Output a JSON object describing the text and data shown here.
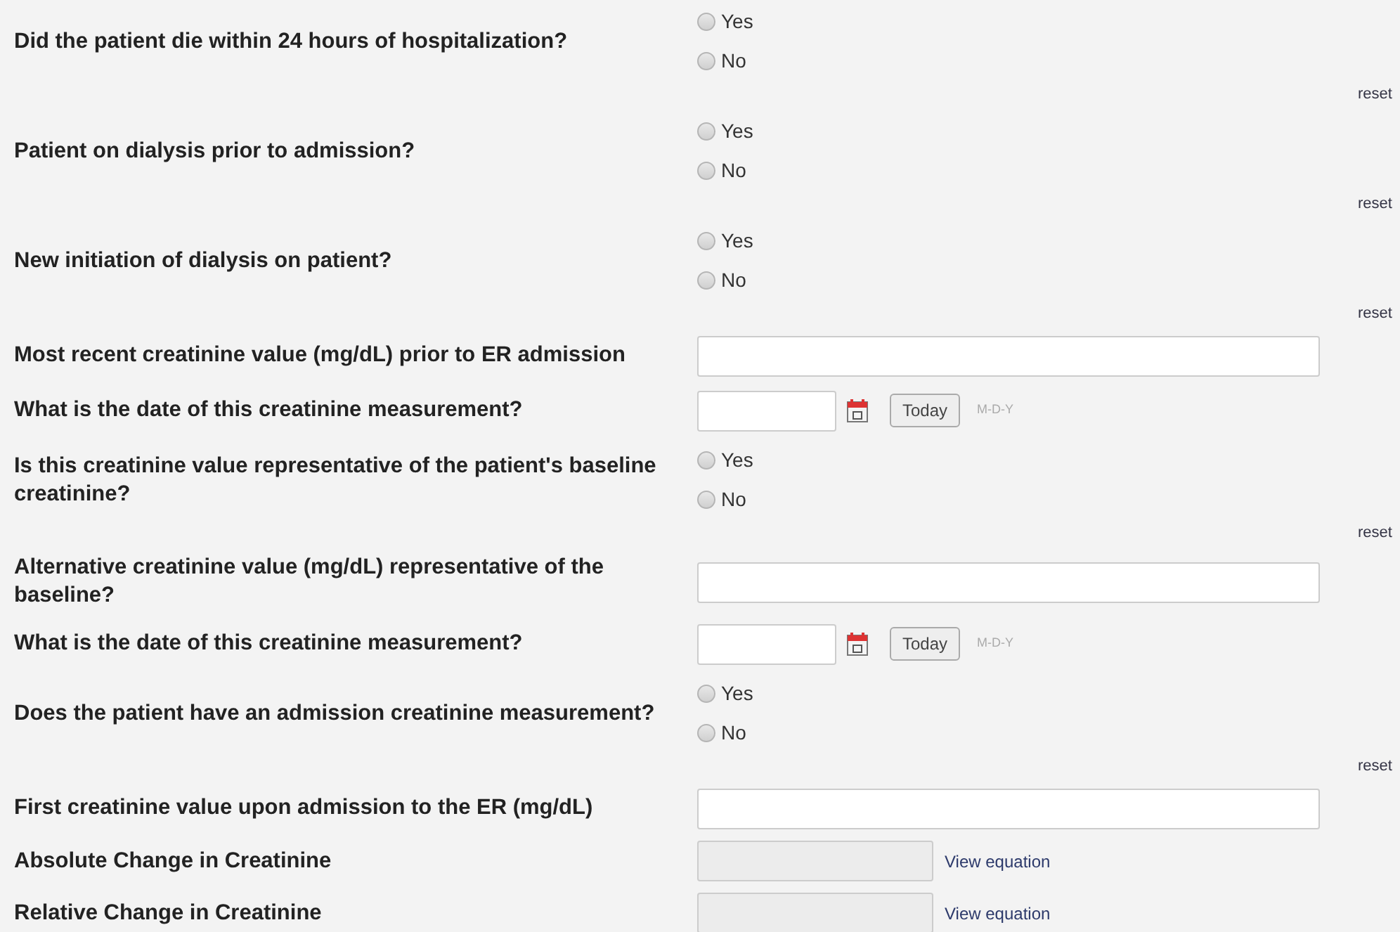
{
  "questions": [
    {
      "kind": "radio",
      "label": "Did the patient die within 24 hours of hospitalization?",
      "options": [
        {
          "label": "Yes",
          "selected": false
        },
        {
          "label": "No",
          "selected": false
        }
      ],
      "reset": "reset"
    },
    {
      "kind": "radio",
      "label": "Patient on dialysis prior to admission?",
      "options": [
        {
          "label": "Yes",
          "selected": false
        },
        {
          "label": "No",
          "selected": false
        }
      ],
      "reset": "reset"
    },
    {
      "kind": "radio",
      "label": "New initiation of dialysis on patient?",
      "options": [
        {
          "label": "Yes",
          "selected": false
        },
        {
          "label": "No",
          "selected": false
        }
      ],
      "reset": "reset"
    },
    {
      "kind": "text",
      "label": "Most recent creatinine value (mg/dL) prior to ER admission"
    },
    {
      "kind": "date",
      "label": "What is the date of this creatinine measurement?",
      "button": "Today",
      "format": "M-D-Y"
    },
    {
      "kind": "radio",
      "label": "Is this creatinine value representative of the patient's baseline creatinine?",
      "options": [
        {
          "label": "Yes",
          "selected": false
        },
        {
          "label": "No",
          "selected": false
        }
      ],
      "reset": "reset"
    },
    {
      "kind": "text",
      "label": "Alternative creatinine value (mg/dL) representative of the baseline?"
    },
    {
      "kind": "date",
      "label": "What is the date of this creatinine measurement?",
      "button": "Today",
      "format": "M-D-Y"
    },
    {
      "kind": "radio",
      "label": "Does the patient have an admission creatinine measurement?",
      "options": [
        {
          "label": "Yes",
          "selected": false
        },
        {
          "label": "No",
          "selected": false
        }
      ],
      "reset": "reset"
    },
    {
      "kind": "text",
      "label": "First creatinine value upon admission to the ER (mg/dL)"
    },
    {
      "kind": "calc",
      "label": "Absolute Change in Creatinine",
      "link": "View equation"
    },
    {
      "kind": "calc",
      "label": "Relative Change in Creatinine",
      "link": "View equation"
    }
  ]
}
